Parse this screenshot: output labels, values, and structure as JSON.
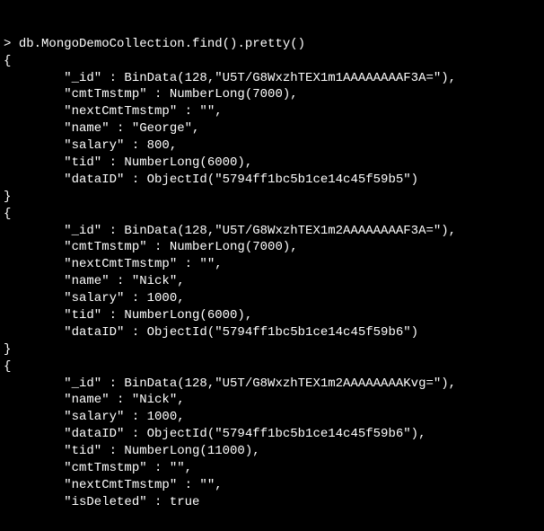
{
  "command": "db.MongoDemoCollection.find().pretty()",
  "braces": {
    "open": "{",
    "close": "}"
  },
  "docs": [
    {
      "lines": [
        "\"_id\" : BinData(128,\"U5T/G8WxzhTEX1m1AAAAAAAAF3A=\"),",
        "\"cmtTmstmp\" : NumberLong(7000),",
        "\"nextCmtTmstmp\" : \"\",",
        "\"name\" : \"George\",",
        "\"salary\" : 800,",
        "\"tid\" : NumberLong(6000),",
        "\"dataID\" : ObjectId(\"5794ff1bc5b1ce14c45f59b5\")"
      ]
    },
    {
      "lines": [
        "\"_id\" : BinData(128,\"U5T/G8WxzhTEX1m2AAAAAAAAF3A=\"),",
        "\"cmtTmstmp\" : NumberLong(7000),",
        "\"nextCmtTmstmp\" : \"\",",
        "\"name\" : \"Nick\",",
        "\"salary\" : 1000,",
        "\"tid\" : NumberLong(6000),",
        "\"dataID\" : ObjectId(\"5794ff1bc5b1ce14c45f59b6\")"
      ]
    },
    {
      "lines": [
        "\"_id\" : BinData(128,\"U5T/G8WxzhTEX1m2AAAAAAAAKvg=\"),",
        "\"name\" : \"Nick\",",
        "\"salary\" : 1000,",
        "\"dataID\" : ObjectId(\"5794ff1bc5b1ce14c45f59b6\"),",
        "\"tid\" : NumberLong(11000),",
        "\"cmtTmstmp\" : \"\",",
        "\"nextCmtTmstmp\" : \"\",",
        "\"isDeleted\" : true"
      ]
    }
  ]
}
